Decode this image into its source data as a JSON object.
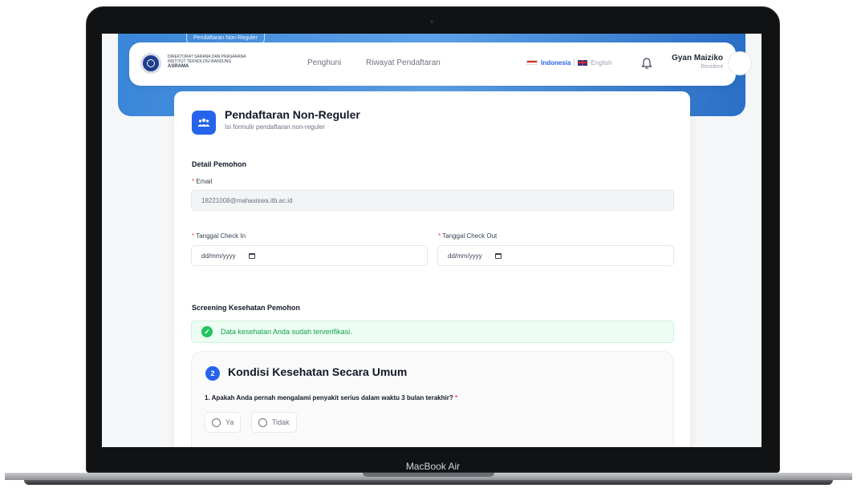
{
  "device": {
    "label": "MacBook Air"
  },
  "header": {
    "breadcrumb": "Pendaftaran Non-Reguler",
    "logo": {
      "line1": "DIREKTORAT SARANA DAN PRASARANA",
      "line2": "INSTITUT TEKNOLOGI BANDUNG",
      "line3": "ASRAMA"
    },
    "nav": [
      {
        "label": "Penghuni"
      },
      {
        "label": "Riwayat Pendaftaran"
      }
    ],
    "languages": [
      {
        "label": "Indonesia",
        "flag": "flag-id-icon",
        "active": true
      },
      {
        "label": "English",
        "flag": "flag-gb-icon",
        "active": false
      }
    ],
    "user": {
      "name": "Gyan Maiziko",
      "role": "Resident"
    }
  },
  "form": {
    "title": "Pendaftaran Non-Reguler",
    "subtitle": "Isi formulir pendaftaran non-reguler",
    "applicant_section": "Detail Pemohon",
    "email": {
      "label": "Email",
      "value": "18221008@mahasiswa.itb.ac.id"
    },
    "check_in": {
      "label": "Tanggal Check In",
      "placeholder": "dd/mm/yyyy"
    },
    "check_out": {
      "label": "Tanggal Check Out",
      "placeholder": "dd/mm/yyyy"
    },
    "screening_section": "Screening Kesehatan Pemohon",
    "verified_message": "Data kesehatan Anda sudah terverifikasi.",
    "health": {
      "step": "2",
      "title": "Kondisi Kesehatan Secara Umum",
      "question": "1. Apakah Anda pernah mengalami penyakit serius dalam waktu 3 bulan terakhir?",
      "options": [
        {
          "label": "Ya"
        },
        {
          "label": "Tidak"
        }
      ]
    }
  },
  "colors": {
    "primary": "#2563eb",
    "success": "#22c55e",
    "required": "#ef4444"
  }
}
